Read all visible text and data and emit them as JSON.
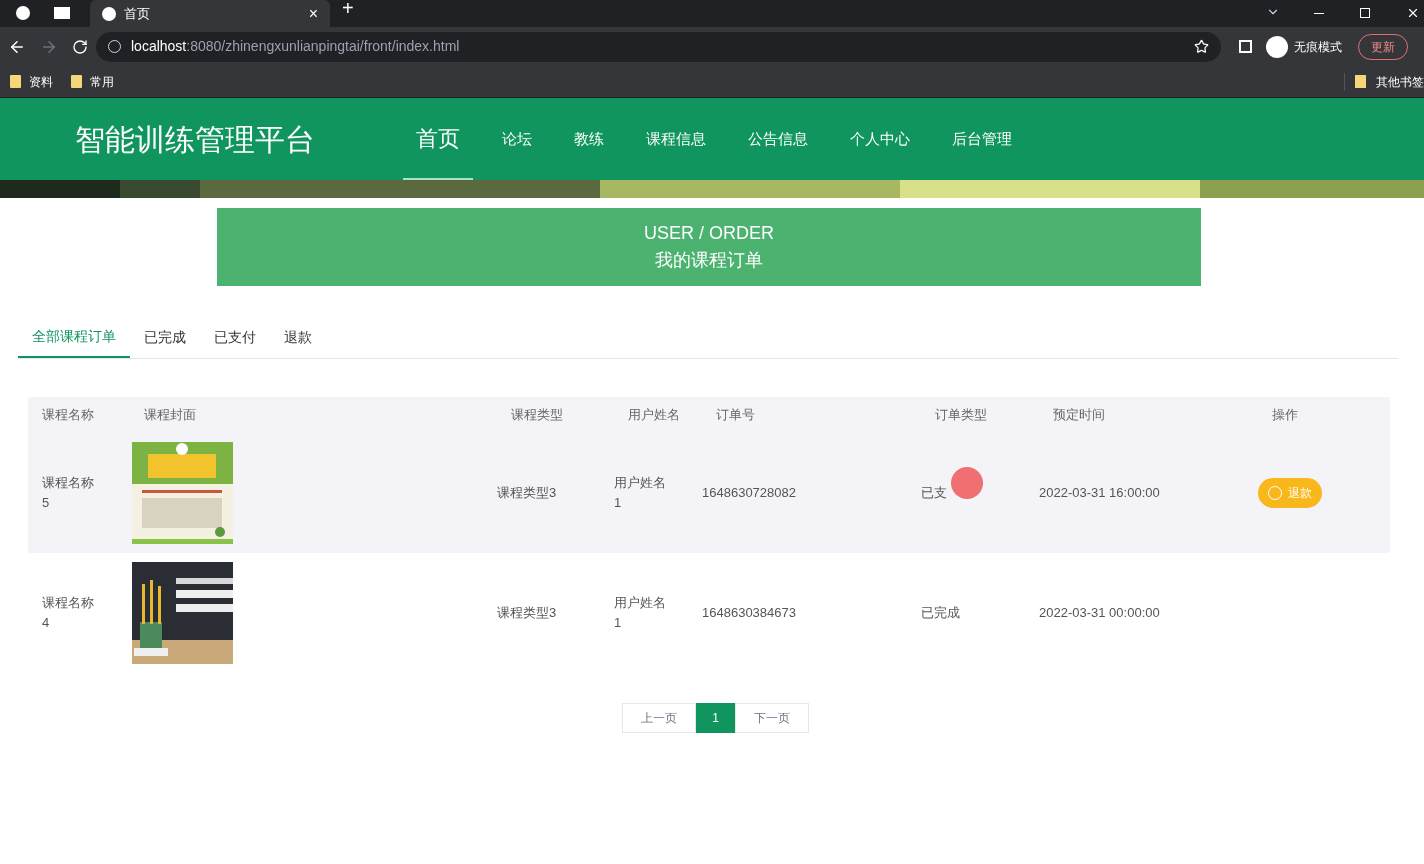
{
  "browser": {
    "tabs": [
      {
        "title": "首页",
        "selected": true
      }
    ],
    "close_tab": "×",
    "new_tab": "+",
    "url_host": "localhost",
    "url_path": ":8080/zhinengxunlianpingtai/front/index.html",
    "profile": "无痕模式",
    "update": "更新",
    "bookmarks": [
      "资料",
      "常用"
    ],
    "other_bookmarks": "其他书签"
  },
  "header": {
    "title": "智能训练管理平台",
    "nav": [
      {
        "label": "首页",
        "selected": true
      },
      {
        "label": "论坛",
        "selected": false
      },
      {
        "label": "教练",
        "selected": false
      },
      {
        "label": "课程信息",
        "selected": false
      },
      {
        "label": "公告信息",
        "selected": false
      },
      {
        "label": "个人中心",
        "selected": false
      },
      {
        "label": "后台管理",
        "selected": false
      }
    ]
  },
  "banner": {
    "subtitle": "USER / ORDER",
    "title": "我的课程订单"
  },
  "tabs": [
    {
      "label": "全部课程订单",
      "selected": true
    },
    {
      "label": "已完成",
      "selected": false
    },
    {
      "label": "已支付",
      "selected": false
    },
    {
      "label": "退款",
      "selected": false
    }
  ],
  "table": {
    "columns": [
      "课程名称",
      "课程封面",
      "课程类型",
      "用户姓名",
      "订单号",
      "订单类型",
      "预定时间",
      "操作"
    ],
    "rows": [
      {
        "name": "课程名称\n5",
        "type": "课程类型3",
        "user": "用户姓名\n1",
        "order_no": "1648630728082",
        "status": "已支",
        "time": "2022-03-31 16:00:00",
        "action": "退款",
        "hovered": true,
        "cursor": true
      },
      {
        "name": "课程名称\n4",
        "type": "课程类型3",
        "user": "用户姓名\n1",
        "order_no": "1648630384673",
        "status": "已完成",
        "time": "2022-03-31 00:00:00",
        "hovered": false,
        "cursor": false
      }
    ]
  },
  "pagination": {
    "prev": "上一页",
    "pages": [
      {
        "label": "1",
        "selected": true
      }
    ],
    "next": "下一页"
  }
}
